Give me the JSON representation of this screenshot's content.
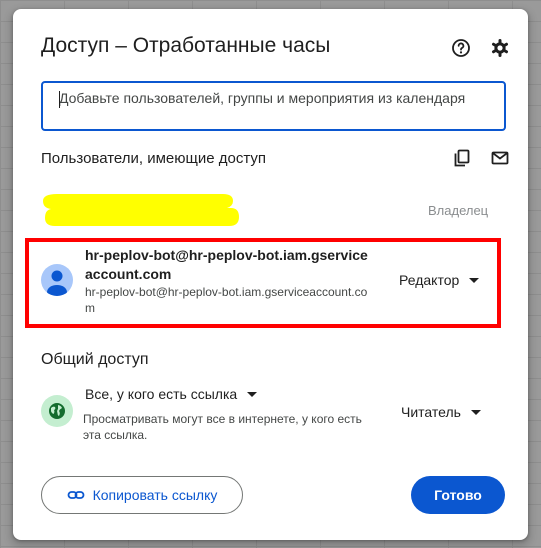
{
  "dialog": {
    "title": "Доступ – Отработанные часы"
  },
  "search": {
    "placeholder": "Добавьте пользователей, группы и мероприятия из календаря",
    "value": ""
  },
  "users_section": {
    "label": "Пользователи, имеющие доступ",
    "owner": {
      "name": "",
      "role": "Владелец"
    },
    "service_account": {
      "name": "hr-peplov-bot@hr-peplov-bot.iam.gserviceaccount.com",
      "email": "hr-peplov-bot@hr-peplov-bot.iam.gserviceaccount.com",
      "role": "Редактор"
    }
  },
  "general_access": {
    "label": "Общий доступ",
    "link_option": "Все, у кого есть ссылка",
    "description": "Просматривать могут все в интернете, у кого есть эта ссылка.",
    "role": "Читатель"
  },
  "footer": {
    "copy_link_label": "Копировать ссылку",
    "done_label": "Готово"
  },
  "icons": {
    "help": "help-circle-icon",
    "settings": "gear-icon",
    "copy": "copy-icon",
    "email": "email-icon",
    "avatar": "person-icon",
    "globe": "globe-icon",
    "link": "link-icon"
  },
  "colors": {
    "accent": "#0b57d0",
    "highlight": "#ff0000",
    "redaction": "#ffff00",
    "avatar_bg": "#a8c7fa",
    "globe_bg": "#c4eed0"
  }
}
